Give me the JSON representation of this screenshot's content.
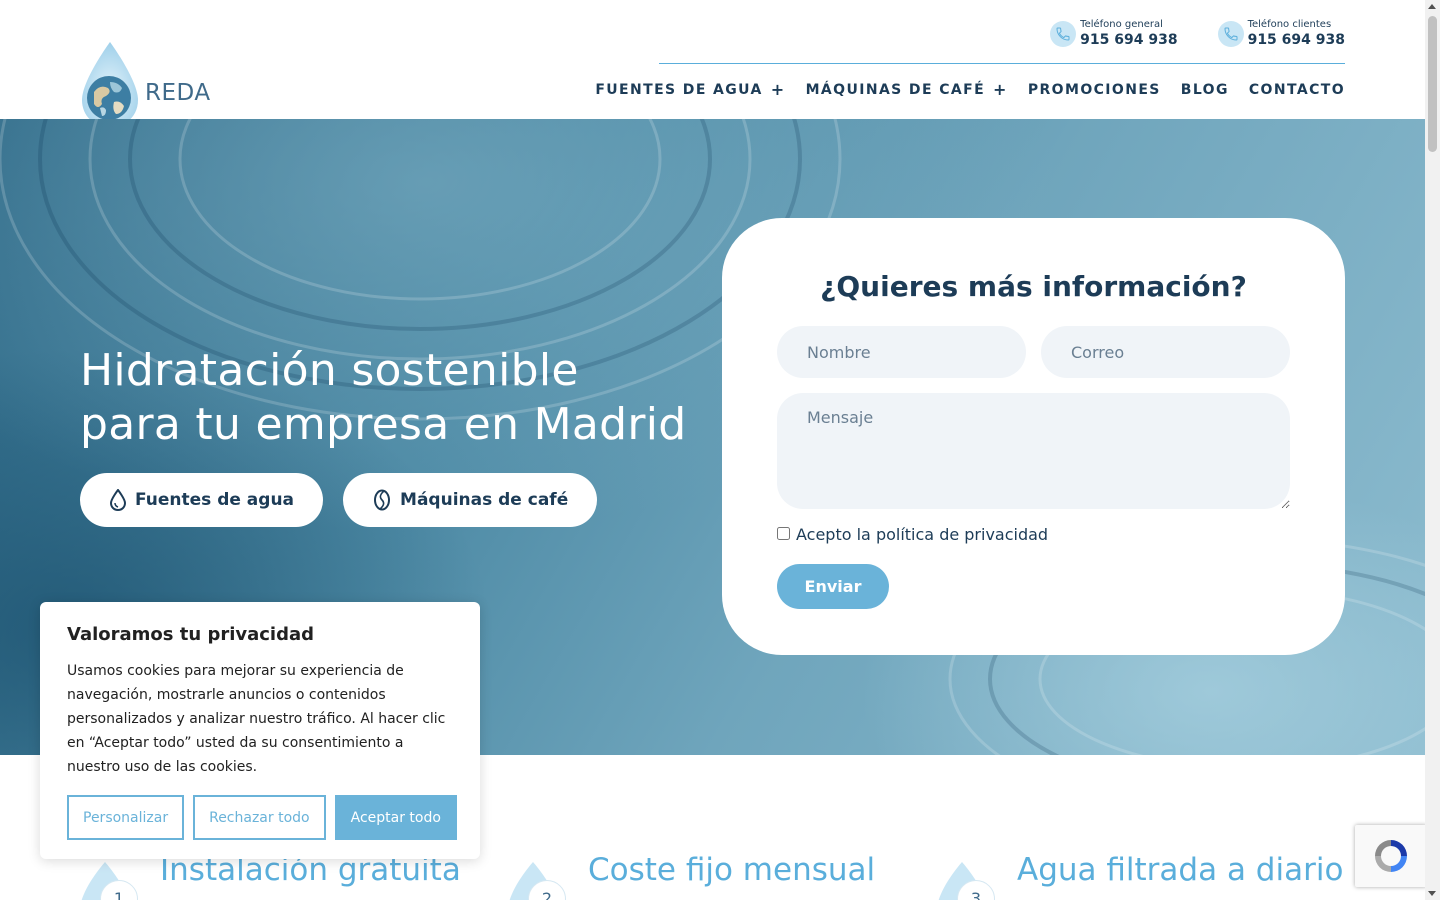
{
  "brand": {
    "name": "REDA"
  },
  "header": {
    "phones": [
      {
        "label": "Teléfono general",
        "number": "915 694 938",
        "icon": "phone-icon"
      },
      {
        "label": "Teléfono clientes",
        "number": "915 694 938",
        "icon": "phone-icon"
      }
    ],
    "nav": [
      {
        "label": "FUENTES DE AGUA",
        "has_submenu": true
      },
      {
        "label": "MÁQUINAS DE CAFÉ",
        "has_submenu": true
      },
      {
        "label": "PROMOCIONES",
        "has_submenu": false
      },
      {
        "label": "BLOG",
        "has_submenu": false
      },
      {
        "label": "CONTACTO",
        "has_submenu": false
      }
    ],
    "submenu_glyph": "+"
  },
  "hero": {
    "title_line1": "Hidratación sostenible",
    "title_line2": "para tu empresa en Madrid",
    "buttons": [
      {
        "label": "Fuentes de agua",
        "icon": "water-drop-icon"
      },
      {
        "label": "Máquinas de café",
        "icon": "coffee-bean-icon"
      }
    ]
  },
  "form": {
    "title": "¿Quieres más información?",
    "name_placeholder": "Nombre",
    "email_placeholder": "Correo",
    "message_placeholder": "Mensaje",
    "privacy_label": "Acepto la política de privacidad",
    "privacy_checked": false,
    "submit_label": "Enviar"
  },
  "features": [
    {
      "number": "1",
      "title": "Instalación gratuita"
    },
    {
      "number": "2",
      "title": "Coste fijo mensual"
    },
    {
      "number": "3",
      "title": "Agua filtrada a diario"
    }
  ],
  "cookie_banner": {
    "title": "Valoramos tu privacidad",
    "text": "Usamos cookies para mejorar su experiencia de navegación, mostrarle anuncios o contenidos personalizados y analizar nuestro tráfico. Al hacer clic en “Aceptar todo” usted da su consentimiento a nuestro uso de las cookies.",
    "customize_label": "Personalizar",
    "reject_label": "Rechazar todo",
    "accept_label": "Aceptar todo"
  },
  "colors": {
    "primary_dark": "#1d3c57",
    "accent_blue": "#6ab3d9",
    "light_blue": "#c9e6f5",
    "input_bg": "#f0f4f8"
  }
}
